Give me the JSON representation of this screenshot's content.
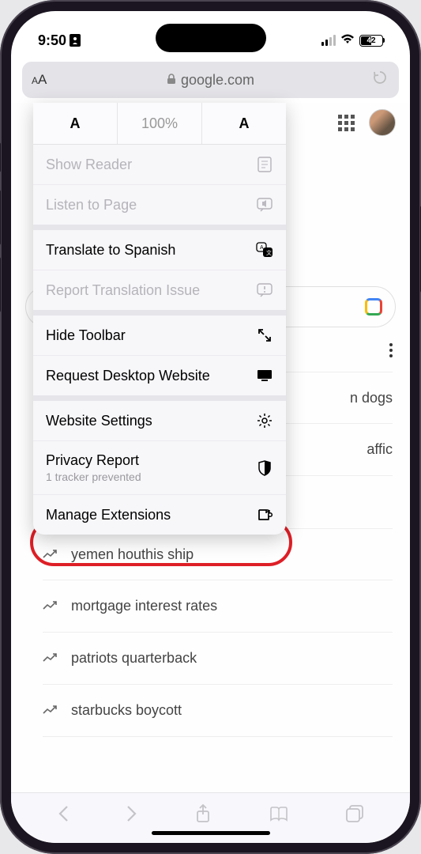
{
  "status": {
    "time": "9:50",
    "battery": "42"
  },
  "url_bar": {
    "domain": "google.com"
  },
  "zoom": {
    "percent": "100%"
  },
  "menu": {
    "show_reader": "Show Reader",
    "listen": "Listen to Page",
    "translate": "Translate to Spanish",
    "report_trans": "Report Translation Issue",
    "hide_toolbar": "Hide Toolbar",
    "desktop": "Request Desktop Website",
    "website_settings": "Website Settings",
    "privacy": "Privacy Report",
    "privacy_sub": "1 tracker prevented",
    "extensions": "Manage Extensions"
  },
  "trending": {
    "items": [
      "n dogs",
      "affic",
      "yemen houthis ship",
      "mortgage interest rates",
      "patriots quarterback",
      "starbucks boycott"
    ]
  }
}
